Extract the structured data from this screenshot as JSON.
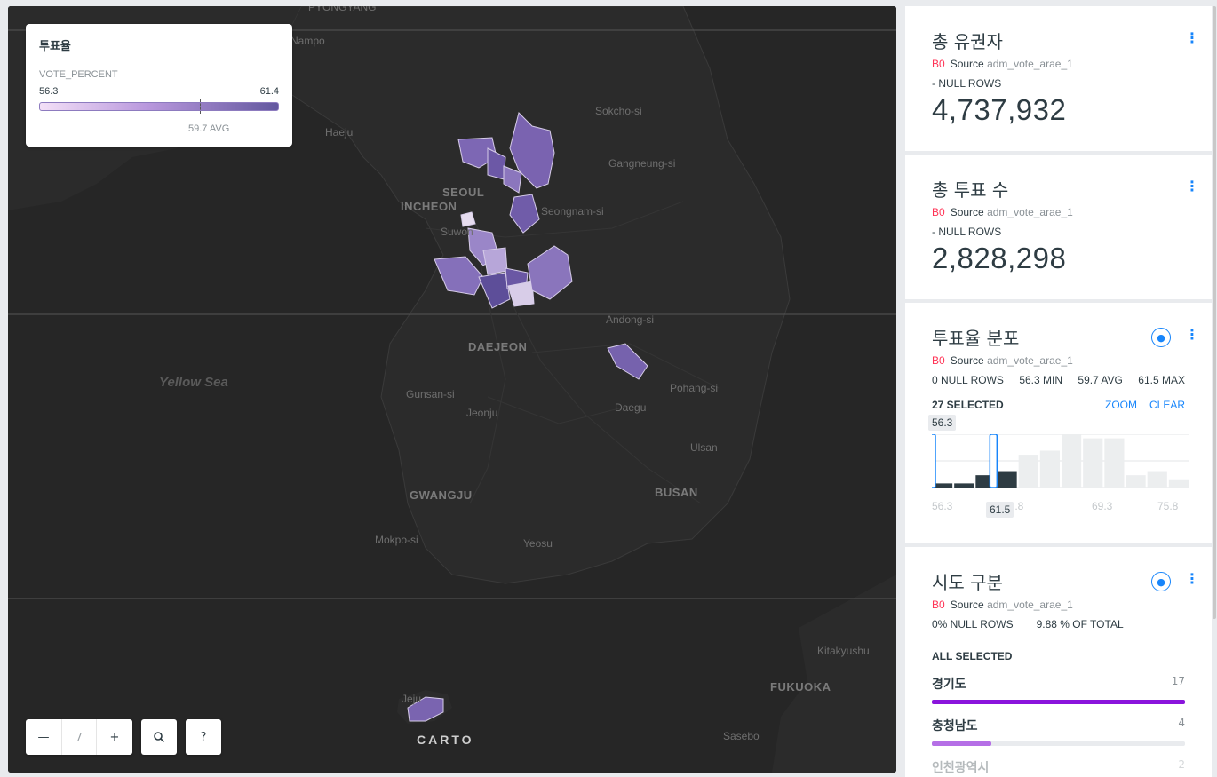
{
  "map": {
    "cities": [
      "Haeju",
      "SEOUL",
      "INCHEON",
      "Suwon",
      "Seongnam-si",
      "Sokcho-si",
      "Gangneung-si",
      "DAEJEON",
      "Andong-si",
      "Gunsan-si",
      "Jeonju",
      "Pohang-si",
      "Daegu",
      "Ulsan",
      "GWANGJU",
      "BUSAN",
      "Mokpo-si",
      "Yeosu",
      "Kitakyushu",
      "FUKUOKA",
      "Sasebo",
      "Jeju",
      "Nampo",
      "PYONGYANG"
    ],
    "sea": "Yellow Sea",
    "attribution": "CARTO"
  },
  "legend": {
    "title": "투표율",
    "field": "VOTE_PERCENT",
    "min": "56.3",
    "max": "61.4",
    "avg": "59.7 AVG"
  },
  "zoom": {
    "minus": "—",
    "level": "7",
    "plus": "+",
    "search_icon": "search-icon",
    "help": "?"
  },
  "widgets": {
    "voters": {
      "title": "총 유권자",
      "badge": "B0",
      "source_label": "Source",
      "source": "adm_vote_arae_1",
      "nulls": "- NULL ROWS",
      "value": "4,737,932"
    },
    "votes": {
      "title": "총 투표 수",
      "badge": "B0",
      "source_label": "Source",
      "source": "adm_vote_arae_1",
      "nulls": "- NULL ROWS",
      "value": "2,828,298"
    },
    "histogram": {
      "title": "투표율 분포",
      "badge": "B0",
      "source_label": "Source",
      "source": "adm_vote_arae_1",
      "nulls": "0 NULL ROWS",
      "min": "56.3 MIN",
      "avg": "59.7 AVG",
      "max": "61.5 MAX",
      "selected": "27 SELECTED",
      "zoom": "ZOOM",
      "clear": "CLEAR",
      "handle_left": "56.3",
      "handle_right": "61.5",
      "ticks": [
        "56.3",
        "62.8",
        "69.3",
        "75.8"
      ]
    },
    "category": {
      "title": "시도 구분",
      "badge": "B0",
      "source_label": "Source",
      "source": "adm_vote_arae_1",
      "nulls": "0% NULL ROWS",
      "total": "9.88 % OF TOTAL",
      "selected": "ALL SELECTED",
      "items": [
        {
          "label": "경기도",
          "count": "17",
          "fill": 1.0,
          "color": "#8a14dc"
        },
        {
          "label": "충청남도",
          "count": "4",
          "fill": 0.235,
          "color": "#b56fe6"
        },
        {
          "label": "인천광역시",
          "count": "2",
          "fill": 0.12,
          "color": "#d4b3f0"
        }
      ]
    }
  },
  "chart_data": {
    "type": "bar",
    "title": "투표율 분포",
    "x": [
      56.3,
      58.0,
      59.6,
      61.2,
      62.8,
      64.4,
      66.0,
      67.7,
      69.3,
      70.9,
      72.5,
      74.1
    ],
    "values": [
      1,
      1,
      3,
      4,
      8,
      9,
      13,
      12,
      12,
      3,
      4,
      2
    ],
    "selected_range": [
      56.3,
      61.5
    ],
    "xlim": [
      56.3,
      75.8
    ]
  }
}
